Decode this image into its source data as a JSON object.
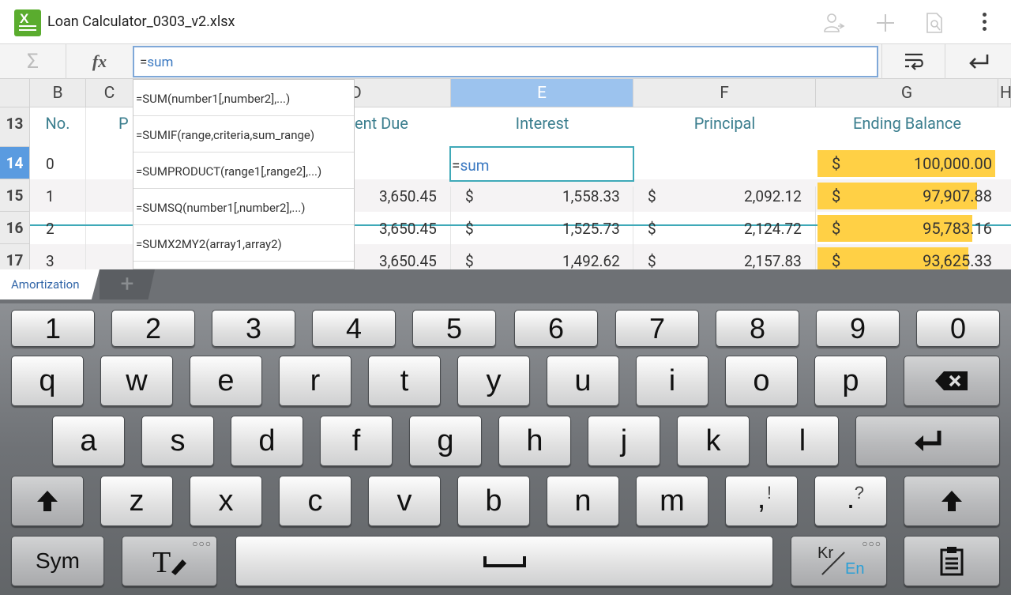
{
  "app": {
    "title": "Loan Calculator_0303_v2.xlsx",
    "accent": "#5aac2e"
  },
  "formula_bar": {
    "sigma_icon": "sigma-icon",
    "fx_label": "fx",
    "equals": "=",
    "text": "sum"
  },
  "columns": [
    "B",
    "C",
    "D",
    "E",
    "F",
    "G",
    "H"
  ],
  "selected_column": "E",
  "header_row": {
    "row": "13",
    "labels": [
      "No.",
      "P",
      "ent Due",
      "Interest",
      "Principal",
      "Ending Balance"
    ]
  },
  "rows": [
    {
      "row": "14",
      "no": "0",
      "due": "",
      "interest_sym": "",
      "interest": "",
      "principal_sym": "",
      "principal": "",
      "bal_sym": "$",
      "balance": "100,000.00"
    },
    {
      "row": "15",
      "no": "1",
      "due": "3,650.45",
      "interest_sym": "$",
      "interest": "1,558.33",
      "principal_sym": "$",
      "principal": "2,092.12",
      "bal_sym": "$",
      "balance": "97,907.88"
    },
    {
      "row": "16",
      "no": "2",
      "due": "3,650.45",
      "interest_sym": "$",
      "interest": "1,525.73",
      "principal_sym": "$",
      "principal": "2,124.72",
      "bal_sym": "$",
      "balance": "95,783.16"
    },
    {
      "row": "17",
      "no": "3",
      "due": "3,650.45",
      "interest_sym": "$",
      "interest": "1,492.62",
      "principal_sym": "$",
      "principal": "2,157.83",
      "bal_sym": "$",
      "balance": "93,625.33"
    }
  ],
  "active_cell": {
    "equals": "=",
    "text": "sum"
  },
  "autocomplete": [
    "=SUM(number1[,number2],...)",
    "=SUMIF(range,criteria,sum_range)",
    "=SUMPRODUCT(range1[,range2],...)",
    "=SUMSQ(number1[,number2],...)",
    "=SUMX2MY2(array1,array2)"
  ],
  "sheet_tabs": {
    "active": "Amortization",
    "add": "+"
  },
  "keyboard": {
    "numbers": [
      "1",
      "2",
      "3",
      "4",
      "5",
      "6",
      "7",
      "8",
      "9",
      "0"
    ],
    "row1": [
      "q",
      "w",
      "e",
      "r",
      "t",
      "y",
      "u",
      "i",
      "o",
      "p"
    ],
    "row2": [
      "a",
      "s",
      "d",
      "f",
      "g",
      "h",
      "j",
      "k",
      "l"
    ],
    "row3": [
      "z",
      "x",
      "c",
      "v",
      "b",
      "n",
      "m"
    ],
    "comma": ",",
    "comma_sub": "!",
    "period": ".",
    "period_sub": "?",
    "sym": "Sym",
    "lang_kr": "Kr",
    "lang_en": "En",
    "lang_en_color": "#2a9fd6"
  }
}
